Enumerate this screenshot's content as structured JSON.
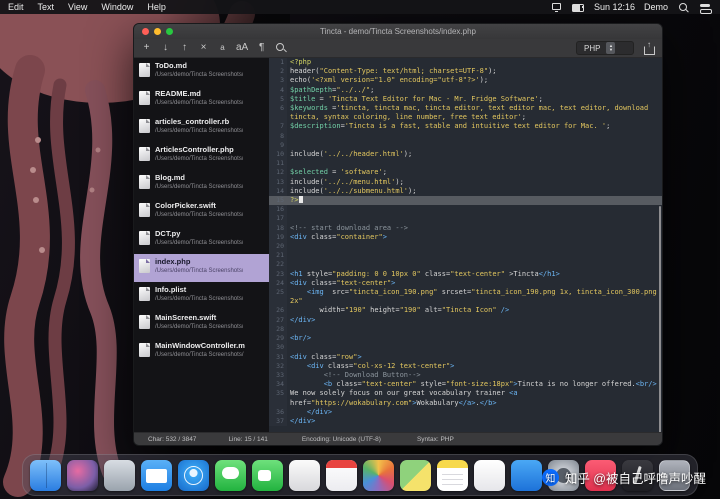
{
  "menubar": {
    "items": [
      "Edit",
      "Text",
      "View",
      "Window",
      "Help"
    ],
    "status_icons": [
      "screen-mirroring-icon",
      "battery-icon"
    ],
    "time": "Sun 12:16",
    "user": "Demo",
    "action_icons": [
      "spotlight-icon",
      "control-center-icon"
    ]
  },
  "window": {
    "title": "Tincta - demo/Tincta Screenshots/index.php",
    "toolbar": {
      "buttons": [
        {
          "name": "new-file",
          "glyph": "+"
        },
        {
          "name": "open-file",
          "glyph": "↓"
        },
        {
          "name": "save-file",
          "glyph": "↑"
        },
        {
          "name": "close-file",
          "glyph": "×"
        },
        {
          "name": "decrease-font",
          "glyph": "a"
        },
        {
          "name": "font-size",
          "glyph": "aA"
        },
        {
          "name": "show-invisibles",
          "glyph": "¶"
        },
        {
          "name": "search",
          "glyph": ""
        }
      ],
      "syntax": "PHP"
    },
    "sidebar": {
      "files": [
        {
          "name": "ToDo.md",
          "path": "/Users/demo/Tincta Screenshots/"
        },
        {
          "name": "README.md",
          "path": "/Users/demo/Tincta Screenshots/"
        },
        {
          "name": "articles_controller.rb",
          "path": "/Users/demo/Tincta Screenshots/"
        },
        {
          "name": "ArticlesController.php",
          "path": "/Users/demo/Tincta Screenshots/"
        },
        {
          "name": "Blog.md",
          "path": "/Users/demo/Tincta Screenshots/"
        },
        {
          "name": "ColorPicker.swift",
          "path": "/Users/demo/Tincta Screenshots/"
        },
        {
          "name": "DCT.py",
          "path": "/Users/demo/Tincta Screenshots/"
        },
        {
          "name": "index.php",
          "path": "/Users/demo/Tincta Screenshots/",
          "selected": true
        },
        {
          "name": "Info.plist",
          "path": "/Users/demo/Tincta Screenshots/"
        },
        {
          "name": "MainScreen.swift",
          "path": "/Users/demo/Tincta Screenshots/"
        },
        {
          "name": "MainWindowController.m",
          "path": "/Users/demo/Tincta Screenshots/"
        }
      ]
    },
    "editor": {
      "lines": [
        {
          "no": "1",
          "segs": [
            [
              "php",
              "<?php"
            ]
          ]
        },
        {
          "no": "2",
          "segs": [
            [
              "plain",
              "header("
            ],
            [
              "str",
              "\"Content-Type: text/html; charset=UTF-8\""
            ],
            [
              "plain",
              ");"
            ]
          ]
        },
        {
          "no": "3",
          "segs": [
            [
              "plain",
              "echo("
            ],
            [
              "str",
              "'<?xml version=\"1.0\" encoding=\"utf-8\"?>'"
            ],
            [
              "plain",
              ");"
            ]
          ]
        },
        {
          "no": "4",
          "segs": [
            [
              "var",
              "$pathDepth"
            ],
            [
              "plain",
              "="
            ],
            [
              "str",
              "\"../../\""
            ],
            [
              "plain",
              ";"
            ]
          ]
        },
        {
          "no": "5",
          "segs": [
            [
              "var",
              "$title"
            ],
            [
              "plain",
              " = "
            ],
            [
              "str",
              "'Tincta Text Editor for Mac - Mr. Fridge Software'"
            ],
            [
              "plain",
              ";"
            ]
          ]
        },
        {
          "no": "6",
          "segs": [
            [
              "var",
              "$keywords"
            ],
            [
              "plain",
              " ="
            ],
            [
              "str",
              "'tincta, tincta mac, tincta editor, text editor mac, text editor, download tincta, syntax coloring, line number, free text editor'"
            ],
            [
              "plain",
              ";"
            ]
          ]
        },
        {
          "no": "7",
          "segs": [
            [
              "var",
              "$description"
            ],
            [
              "plain",
              "="
            ],
            [
              "str",
              "'Tincta is a fast, stable and intuitive text editor for Mac. '"
            ],
            [
              "plain",
              ";"
            ]
          ]
        },
        {
          "no": "8",
          "segs": []
        },
        {
          "no": "9",
          "segs": []
        },
        {
          "no": "10",
          "segs": [
            [
              "plain",
              "include("
            ],
            [
              "str",
              "'../../header.html'"
            ],
            [
              "plain",
              ");"
            ]
          ]
        },
        {
          "no": "11",
          "segs": []
        },
        {
          "no": "12",
          "segs": [
            [
              "var",
              "$selected"
            ],
            [
              "plain",
              " = "
            ],
            [
              "str",
              "'software'"
            ],
            [
              "plain",
              ";"
            ]
          ]
        },
        {
          "no": "13",
          "segs": [
            [
              "plain",
              "include("
            ],
            [
              "str",
              "'../../menu.html'"
            ],
            [
              "plain",
              ");"
            ]
          ]
        },
        {
          "no": "14",
          "segs": [
            [
              "plain",
              "include("
            ],
            [
              "str",
              "'../../submenu.html'"
            ],
            [
              "plain",
              ");"
            ]
          ]
        },
        {
          "no": "15",
          "current": true,
          "cursor": true,
          "segs": [
            [
              "php",
              "?>"
            ]
          ]
        },
        {
          "no": "16",
          "segs": []
        },
        {
          "no": "17",
          "segs": []
        },
        {
          "no": "18",
          "segs": [
            [
              "cmt",
              "<!-- start download area -->"
            ]
          ]
        },
        {
          "no": "19",
          "segs": [
            [
              "tag",
              "<div"
            ],
            [
              "plain",
              " class="
            ],
            [
              "str",
              "\"container\""
            ],
            [
              "tag",
              ">"
            ]
          ]
        },
        {
          "no": "20",
          "segs": []
        },
        {
          "no": "21",
          "segs": []
        },
        {
          "no": "22",
          "segs": []
        },
        {
          "no": "23",
          "segs": [
            [
              "tag",
              "<h1"
            ],
            [
              "plain",
              " style="
            ],
            [
              "str",
              "\"padding: 0 0 10px 0\""
            ],
            [
              "plain",
              " class="
            ],
            [
              "str",
              "\"text-center\""
            ],
            [
              "plain",
              " >Tincta"
            ],
            [
              "tag",
              "</h1>"
            ]
          ]
        },
        {
          "no": "24",
          "segs": [
            [
              "tag",
              "<div"
            ],
            [
              "plain",
              " class="
            ],
            [
              "str",
              "\"text-center\""
            ],
            [
              "tag",
              ">"
            ]
          ]
        },
        {
          "no": "25",
          "segs": [
            [
              "plain",
              "    "
            ],
            [
              "tag",
              "<img"
            ],
            [
              "plain",
              "  src="
            ],
            [
              "str",
              "\"tincta_icon_190.png\""
            ],
            [
              "plain",
              " srcset="
            ],
            [
              "str",
              "\"tincta_icon_190.png 1x, tincta_icon_300.png 2x\""
            ]
          ]
        },
        {
          "no": "26",
          "segs": [
            [
              "plain",
              "       width="
            ],
            [
              "str",
              "\"190\""
            ],
            [
              "plain",
              " height="
            ],
            [
              "str",
              "\"190\""
            ],
            [
              "plain",
              " alt="
            ],
            [
              "str",
              "\"Tincta Icon\""
            ],
            [
              "plain",
              " "
            ],
            [
              "tag",
              "/>"
            ]
          ]
        },
        {
          "no": "27",
          "segs": [
            [
              "tag",
              "</div>"
            ]
          ]
        },
        {
          "no": "28",
          "segs": []
        },
        {
          "no": "29",
          "segs": [
            [
              "tag",
              "<br/>"
            ]
          ]
        },
        {
          "no": "30",
          "segs": []
        },
        {
          "no": "31",
          "segs": [
            [
              "tag",
              "<div"
            ],
            [
              "plain",
              " class="
            ],
            [
              "str",
              "\"row\""
            ],
            [
              "tag",
              ">"
            ]
          ]
        },
        {
          "no": "32",
          "segs": [
            [
              "plain",
              "    "
            ],
            [
              "tag",
              "<div"
            ],
            [
              "plain",
              " class="
            ],
            [
              "str",
              "\"col-xs-12 text-center\""
            ],
            [
              "tag",
              ">"
            ]
          ]
        },
        {
          "no": "33",
          "segs": [
            [
              "plain",
              "        "
            ],
            [
              "cmt",
              "<!-- Download Button-->"
            ]
          ]
        },
        {
          "no": "34",
          "segs": [
            [
              "plain",
              "        "
            ],
            [
              "tag",
              "<b"
            ],
            [
              "plain",
              " class="
            ],
            [
              "str",
              "\"text-center\""
            ],
            [
              "plain",
              " style="
            ],
            [
              "str",
              "\"font-size:18px\""
            ],
            [
              "tag",
              ">"
            ],
            [
              "plain",
              "Tincta is no longer offered."
            ],
            [
              "tag",
              "<br/>"
            ]
          ]
        },
        {
          "no": "35",
          "segs": [
            [
              "plain",
              "We now solely focus on our great vocabulary trainer "
            ],
            [
              "tag",
              "<a"
            ],
            [
              "plain",
              " href="
            ],
            [
              "str",
              "\"https://wokabulary.com\""
            ],
            [
              "tag",
              ">"
            ],
            [
              "plain",
              "Wokabulary"
            ],
            [
              "tag",
              "</a>"
            ],
            [
              "plain",
              "."
            ],
            [
              "tag",
              "</b>"
            ]
          ]
        },
        {
          "no": "36",
          "segs": [
            [
              "plain",
              "    "
            ],
            [
              "tag",
              "</div>"
            ]
          ]
        },
        {
          "no": "37",
          "segs": [
            [
              "tag",
              "</div>"
            ]
          ]
        }
      ]
    },
    "statusbar": {
      "chars": "Char: 532 / 3847",
      "line": "Line: 15 / 141",
      "encoding": "Encoding: Unicode (UTF-8)",
      "syntax": "Syntax: PHP"
    }
  },
  "dock": {
    "apps": [
      {
        "name": "finder",
        "bg": "linear-gradient(180deg,#7ec0fa,#2a7de1)"
      },
      {
        "name": "siri",
        "bg": "radial-gradient(circle at 35% 35%,#e66ba2,#7b5ea7 60%,#1c1c2e)"
      },
      {
        "name": "launchpad",
        "bg": "linear-gradient(180deg,#d8dde3,#9aa3ad)"
      },
      {
        "name": "mail",
        "bg": "linear-gradient(180deg,#5ab0f7,#1d7fe3)"
      },
      {
        "name": "safari",
        "bg": "radial-gradient(circle at 50% 42%,#eaf6ff 16%,#39a5f3 18%,#1668c9)"
      },
      {
        "name": "messages",
        "bg": "linear-gradient(180deg,#6ee17c,#22b33f)"
      },
      {
        "name": "facetime",
        "bg": "linear-gradient(180deg,#6ee17c,#22b33f)"
      },
      {
        "name": "contacts",
        "bg": "linear-gradient(180deg,#fbfbfb,#d8d8dc)"
      },
      {
        "name": "calendar",
        "bg": "linear-gradient(180deg,#ffffff,#ececf0)"
      },
      {
        "name": "photos",
        "bg": "conic-gradient(#f3c14b,#e8743b,#d94f70,#8e6bbf,#4a90d9,#58b368,#f3c14b)"
      },
      {
        "name": "maps",
        "bg": "linear-gradient(135deg,#8fd27c 50%,#f5e26b 50%)"
      },
      {
        "name": "notes",
        "bg": "linear-gradient(180deg,#f7d94c 26%,#ffffff 26%)"
      },
      {
        "name": "reminders",
        "bg": "linear-gradient(180deg,#ffffff,#e6e6ea)"
      },
      {
        "name": "app-store",
        "bg": "linear-gradient(180deg,#4aa8f5,#1d72d9)"
      },
      {
        "name": "system-preferences",
        "bg": "radial-gradient(circle,#c8ccd2 30%,#7d858f)"
      },
      {
        "name": "music",
        "bg": "linear-gradient(180deg,#fb5c74,#e0314e)"
      },
      {
        "name": "tincta",
        "bg": "linear-gradient(180deg,#3a3a40,#1d1d22)"
      },
      {
        "name": "trash",
        "bg": "linear-gradient(180deg,rgba(222,227,236,0.75),rgba(158,166,178,0.6))"
      }
    ]
  },
  "watermark": {
    "logo": "知",
    "text": "知乎 @被自己呼噜声吵醒"
  },
  "colors": {
    "accent_selection": "#b1a3d4",
    "traffic_close": "#ff5f57",
    "traffic_minimize": "#febc2e",
    "traffic_zoom": "#28c840",
    "syntax_string": "#e3c75f",
    "syntax_variable": "#72cfa6",
    "syntax_tag": "#6cb6f5",
    "syntax_comment": "#8b949c",
    "syntax_phptag": "#d3d463",
    "zhihu_blue": "#0b6cff"
  }
}
